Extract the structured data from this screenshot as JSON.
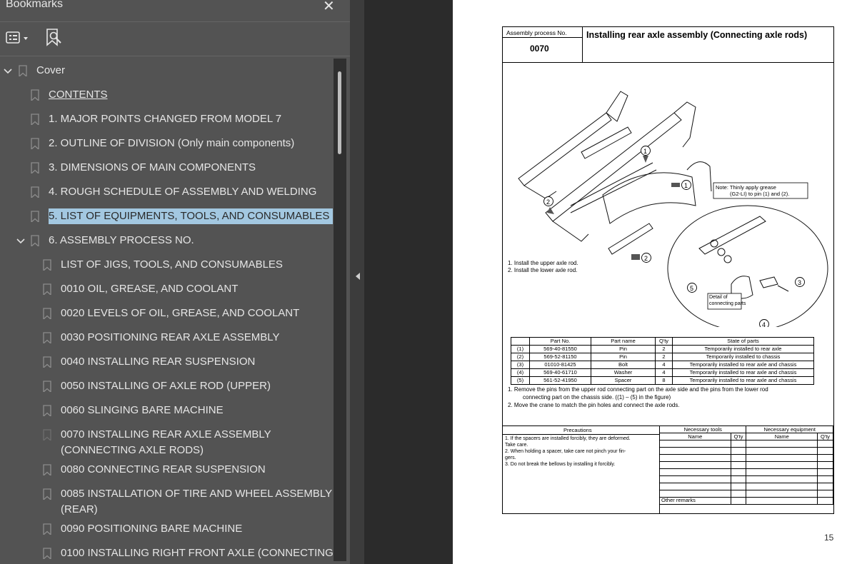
{
  "sidebar": {
    "title": "Bookmarks",
    "close_icon": "close-icon",
    "options_icon": "bookmark-options-icon",
    "find_icon": "find-current-bookmark-icon",
    "items": [
      {
        "label": "Cover"
      },
      {
        "label": "CONTENTS"
      },
      {
        "label": "1. MAJOR POINTS CHANGED FROM MODEL 7"
      },
      {
        "label": "2. OUTLINE OF DIVISION  (Only main components)"
      },
      {
        "label": "3. DIMENSIONS OF MAIN COMPONENTS"
      },
      {
        "label": "4. ROUGH SCHEDULE OF ASSEMBLY AND WELDING"
      },
      {
        "label": "5. LIST OF EQUIPMENTS, TOOLS, AND CONSUMABLES"
      },
      {
        "label": "6. ASSEMBLY PROCESS NO."
      },
      {
        "label": "LIST OF JIGS, TOOLS, AND CONSUMABLES"
      },
      {
        "label": "0010 OIL, GREASE, AND COOLANT"
      },
      {
        "label": "0020 LEVELS OF OIL, GREASE, AND COOLANT"
      },
      {
        "label": "0030 POSITIONING REAR AXLE ASSEMBLY"
      },
      {
        "label": "0040 INSTALLING REAR SUSPENSION"
      },
      {
        "label": "0050 INSTALLING OF AXLE ROD (UPPER)"
      },
      {
        "label": "0060 SLINGING BARE MACHINE"
      },
      {
        "label": "0070 INSTALLING REAR AXLE ASSEMBLY (CONNECTING AXLE RODS)"
      },
      {
        "label": "0080 CONNECTING REAR SUSPENSION"
      },
      {
        "label": "0085 INSTALLATION OF TIRE AND WHEEL ASSEMBLY (REAR)"
      },
      {
        "label": "0090 POSITIONING BARE MACHINE"
      },
      {
        "label": "0100 INSTALLING RIGHT FRONT AXLE (CONNECTING"
      }
    ]
  },
  "document": {
    "process_no_label": "Assembly process No.",
    "process_no": "0070",
    "title": "Installing rear axle assembly (Connecting axle rods)",
    "note_line1": "Note: Thinly apply grease",
    "note_line2": "(G2-LI) to pin (1) and (2).",
    "detail_label1": "Detail of",
    "detail_label2": "connecting parts",
    "callouts": [
      "1",
      "1",
      "2",
      "2",
      "3",
      "4",
      "5"
    ],
    "steps_a": [
      "1.  Install the upper axle rod.",
      "2.  Install the lower axle rod."
    ],
    "parts_headers": [
      "",
      "Part No.",
      "Part name",
      "Q'ty",
      "State of parts"
    ],
    "parts_rows": [
      [
        "(1)",
        "569-40-81550",
        "Pin",
        "2",
        "Temporarily installed to rear axle"
      ],
      [
        "(2)",
        "569-52-81150",
        "Pin",
        "2",
        "Temporarily installed to chassis"
      ],
      [
        "(3)",
        "01010-81425",
        "Bolt",
        "4",
        "Temporarily installed to rear axle and chassis"
      ],
      [
        "(4)",
        "569-40-61710",
        "Washer",
        "4",
        "Temporarily installed to rear axle and chassis"
      ],
      [
        "(5)",
        "561-52-41950",
        "Spacer",
        "8",
        "Temporarily installed to rear axle and chassis"
      ]
    ],
    "steps_b1": "1.   Remove the pins from the upper rod connecting part on the axle side and the pins from the lower rod",
    "steps_b1b": "connecting part on the chassis side.  ((1) – (5) in the figure)",
    "steps_b2": "2.   Move the crane to match the pin holes and connect the axle rods.",
    "precautions_header": "Precautions",
    "precautions": [
      "1.  If the spacers are installed forcibly, they are deformed.",
      "     Take care.",
      "2.  When holding a spacer, take care not pinch your fin-",
      "     gers.",
      "3.  Do not break the bellows by installing it forcibly."
    ],
    "tools_header": "Necessary tools",
    "equipment_header": "Necessary equipment",
    "name_col": "Name",
    "qty_col": "Q'ty",
    "other_remarks": "Other remarks",
    "page_number": "15"
  }
}
